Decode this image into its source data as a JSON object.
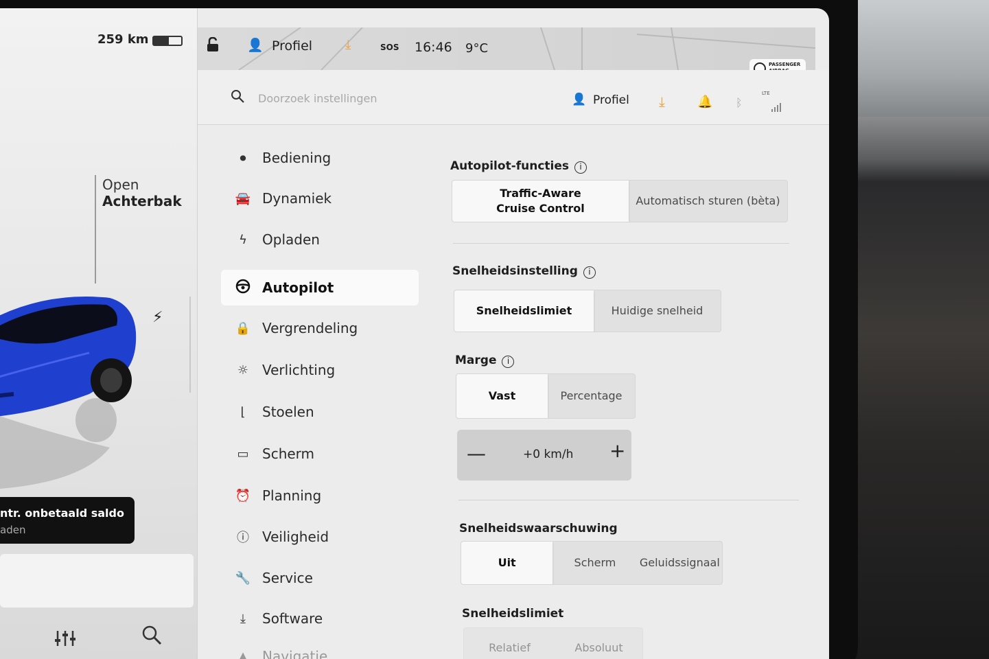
{
  "status": {
    "range": "259 km",
    "battery_level": 0.55,
    "profile": "Profiel",
    "sos": "SOS",
    "time": "16:46",
    "temperature": "9°C",
    "airbag_line1": "PASSENGER",
    "airbag_line2": "AIRBAG"
  },
  "car_panel": {
    "trunk_line1": "Open",
    "trunk_line2": "Achterbak",
    "notice_line1": "ntr. onbetaald saldo",
    "notice_line2": "aden"
  },
  "header": {
    "search_placeholder": "Doorzoek instellingen",
    "profile": "Profiel",
    "signal": "LTE"
  },
  "nav": {
    "items": [
      {
        "label": "Bediening",
        "icon": "toggle-icon"
      },
      {
        "label": "Dynamiek",
        "icon": "car-icon"
      },
      {
        "label": "Opladen",
        "icon": "bolt-icon"
      },
      {
        "label": "Autopilot",
        "icon": "steering-wheel-icon"
      },
      {
        "label": "Vergrendeling",
        "icon": "lock-icon"
      },
      {
        "label": "Verlichting",
        "icon": "light-icon"
      },
      {
        "label": "Stoelen",
        "icon": "seat-icon"
      },
      {
        "label": "Scherm",
        "icon": "display-icon"
      },
      {
        "label": "Planning",
        "icon": "alarm-clock-icon"
      },
      {
        "label": "Veiligheid",
        "icon": "alert-icon"
      },
      {
        "label": "Service",
        "icon": "wrench-icon"
      },
      {
        "label": "Software",
        "icon": "download-icon"
      },
      {
        "label": "Navigatie",
        "icon": "navigation-icon"
      }
    ],
    "active": "Autopilot"
  },
  "autopilot": {
    "features_title": "Autopilot-functies",
    "features_options": [
      "Traffic-Aware\nCruise Control",
      "Automatisch sturen (bèta)"
    ],
    "speed_setting_title": "Snelheidsinstelling",
    "speed_setting_options": [
      "Snelheidslimiet",
      "Huidige snelheid"
    ],
    "margin_title": "Marge",
    "margin_options": [
      "Vast",
      "Percentage"
    ],
    "offset_value": "+0 km/h",
    "warning_title": "Snelheidswaarschuwing",
    "warning_options": [
      "Uit",
      "Scherm",
      "Geluidssignaal"
    ],
    "limit_title": "Snelheidslimiet",
    "limit_options": [
      "Relatief",
      "Absoluut"
    ]
  },
  "colors": {
    "accent_orange": "#e8a13a",
    "car_blue": "#1f3fcf"
  }
}
